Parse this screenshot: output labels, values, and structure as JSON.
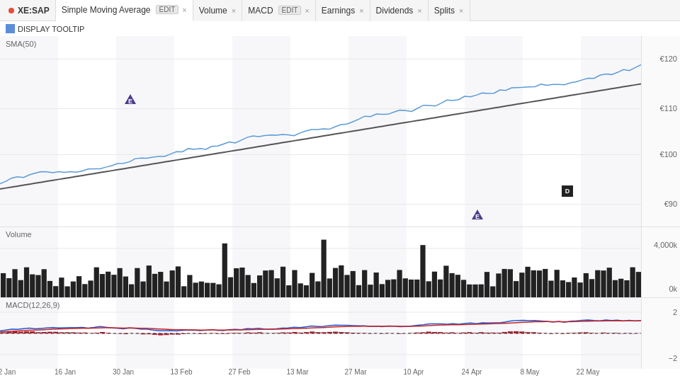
{
  "tabs": [
    {
      "id": "ticker",
      "label": "XE:SAP",
      "hasDot": true,
      "hasClose": false,
      "hasEdit": false
    },
    {
      "id": "sma",
      "label": "Simple Moving Average",
      "hasEdit": true,
      "hasClose": true,
      "active": true
    },
    {
      "id": "volume",
      "label": "Volume",
      "hasEdit": false,
      "hasClose": true
    },
    {
      "id": "macd",
      "label": "MACD",
      "hasEdit": true,
      "hasClose": true
    },
    {
      "id": "earnings",
      "label": "Earnings",
      "hasEdit": false,
      "hasClose": true
    },
    {
      "id": "dividends",
      "label": "Dividends",
      "hasEdit": false,
      "hasClose": true
    },
    {
      "id": "splits",
      "label": "Splits",
      "hasEdit": false,
      "hasClose": true
    }
  ],
  "tooltip": {
    "label": "DISPLAY TOOLTIP",
    "checked": true
  },
  "charts": {
    "sma_label": "SMA(50)",
    "volume_label": "Volume",
    "macd_label": "MACD(12,26,9)",
    "y_labels_main": [
      "€120",
      "€110",
      "€100",
      "€90"
    ],
    "y_labels_volume": [
      "4,000k",
      "0k"
    ],
    "y_labels_macd": [
      "2",
      "-2"
    ],
    "x_labels": [
      "2 Jan",
      "16 Jan",
      "30 Jan",
      "13 Feb",
      "27 Feb",
      "13 Mar",
      "27 Mar",
      "10 Apr",
      "24 Apr",
      "8 May",
      "22 May"
    ]
  },
  "colors": {
    "price_line": "#5b9bd5",
    "sma_line": "#555",
    "volume_bars": "#222",
    "macd_line": "#2255cc",
    "signal_line": "#cc2222",
    "histogram": "#aa2222",
    "marker_color": "#4b3b8c",
    "tab_active_bg": "#ffffff",
    "tab_inactive_bg": "#f5f5f5"
  }
}
